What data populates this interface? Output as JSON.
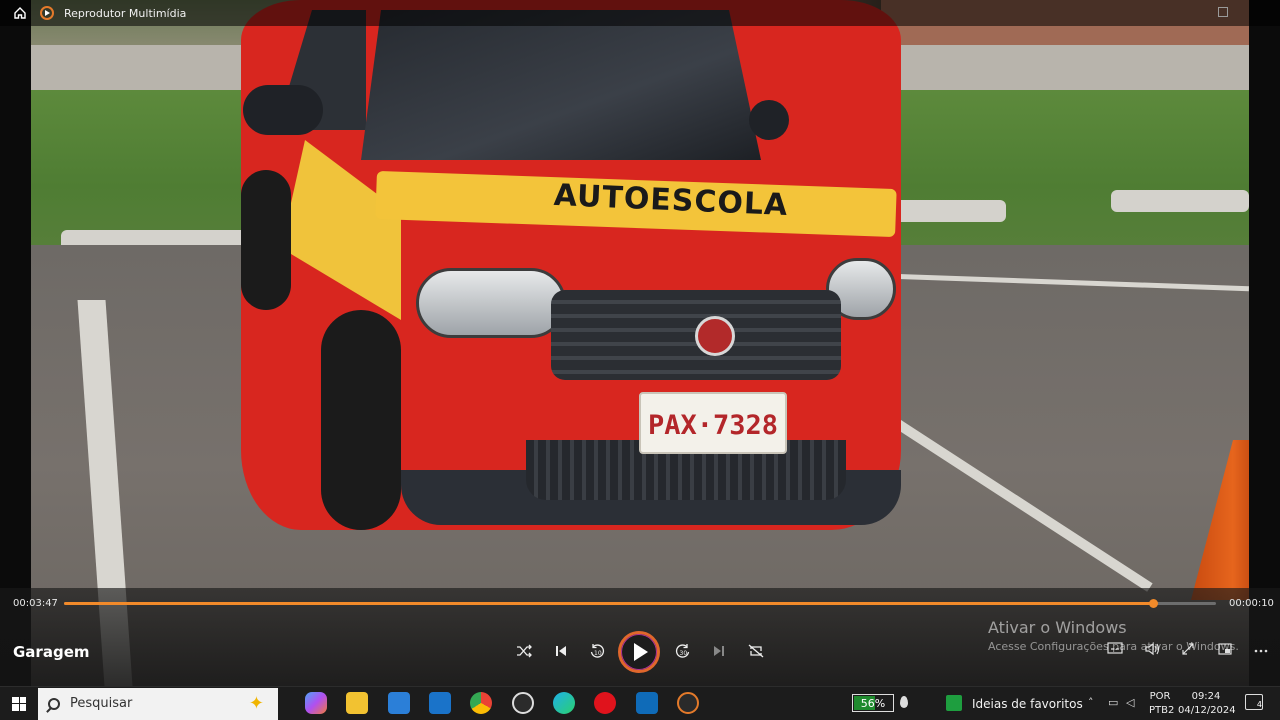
{
  "window": {
    "title": "Reprodutor Multimídia",
    "home_icon": "home-icon",
    "app_icon": "media-player-icon"
  },
  "scene": {
    "hood_text": "AUTOESCOLA",
    "plate_text": "PAX·7328"
  },
  "player": {
    "media_title": "Garagem",
    "current_time": "00:03:47",
    "total_time": "00:00:10",
    "progress": 0.945,
    "accent_color": "#f28a2a",
    "controls": [
      "shuffle-icon",
      "previous-icon",
      "rewind-10-icon",
      "play-icon",
      "forward-30-icon",
      "next-icon",
      "repeat-icon"
    ],
    "right_controls": [
      "captions-icon",
      "volume-icon",
      "fullscreen-icon",
      "miniplayer-icon",
      "more-icon"
    ]
  },
  "activation": {
    "title": "Ativar o Windows",
    "subtitle": "Acesse Configurações para ativar o Windows."
  },
  "taskbar": {
    "search_placeholder": "Pesquisar",
    "battery_percent": "56%",
    "battery_level": 0.56,
    "battery_color": "#1f8a2e",
    "news_text": "Ideias de favoritos",
    "lang_line1": "POR",
    "lang_line2": "PTB2",
    "time": "09:24",
    "date": "04/12/2024",
    "notification_count": "4",
    "apps": [
      "copilot-icon",
      "file-explorer-icon",
      "store-icon",
      "mail-icon",
      "chrome-icon",
      "obs-icon",
      "edge-icon",
      "opera-icon",
      "app-icon",
      "media-player-icon"
    ]
  }
}
